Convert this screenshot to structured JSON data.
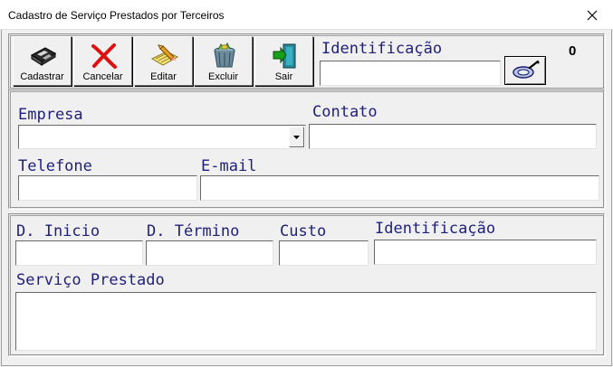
{
  "window": {
    "title": "Cadastro de Serviço Prestados por Terceiros"
  },
  "toolbar": {
    "cadastrar": "Cadastrar",
    "cancelar": "Cancelar",
    "editar": "Editar",
    "excluir": "Excluir",
    "sair": "Sair"
  },
  "identificacao": {
    "label": "Identificação",
    "value": "0",
    "input_value": ""
  },
  "empresa_panel": {
    "empresa_label": "Empresa",
    "empresa_value": "",
    "contato_label": "Contato",
    "contato_value": "",
    "telefone_label": "Telefone",
    "telefone_value": "",
    "email_label": "E-mail",
    "email_value": ""
  },
  "servico_panel": {
    "d_inicio_label": "D. Inicio",
    "d_termino_label": "D. Término",
    "custo_label": "Custo",
    "identificacao_label": "Identificação",
    "servico_prestado_label": "Serviço Prestado"
  },
  "icons": {
    "close": "close-icon",
    "save": "floppy-disk-icon",
    "cancel": "red-x-icon",
    "edit": "pencil-notepad-icon",
    "delete": "trash-can-icon",
    "exit": "exit-door-icon",
    "search": "search-icon"
  },
  "colors": {
    "label_text": "#1f1f7a",
    "window_bg": "#f0f0f0"
  }
}
